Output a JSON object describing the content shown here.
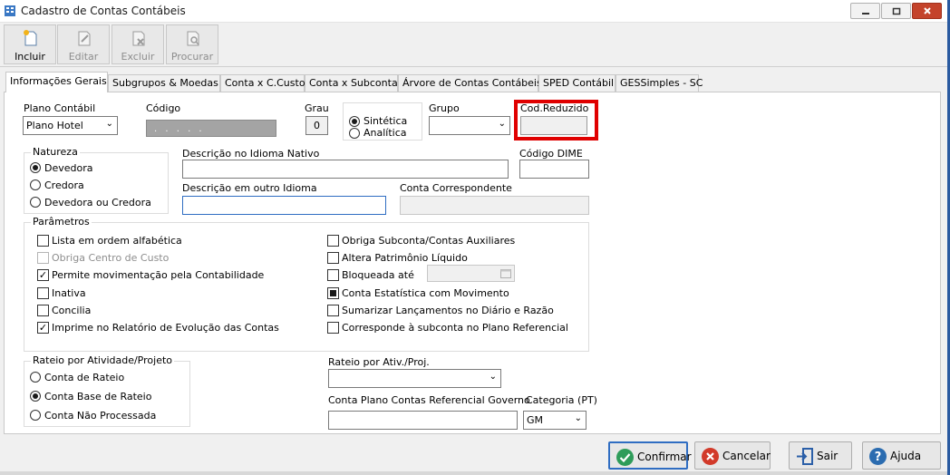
{
  "window": {
    "title": "Cadastro de Contas Contábeis"
  },
  "toolbar": {
    "incluir": "Incluir",
    "editar": "Editar",
    "excluir": "Excluir",
    "procurar": "Procurar"
  },
  "tabs": [
    "Informações Gerais",
    "Subgrupos & Moedas",
    "Conta x C.Custo",
    "Conta x Subconta",
    "Árvore de Contas Contábeis",
    "SPED Contábil",
    "GESSimples - SC"
  ],
  "form": {
    "plano_label": "Plano Contábil",
    "plano_value": "Plano Hotel",
    "codigo_label": "Código",
    "codigo_value": ". . . . .",
    "grau_label": "Grau",
    "grau_value": "0",
    "tipo_sintetica": "Sintética",
    "tipo_analitica": "Analítica",
    "grupo_label": "Grupo",
    "cod_reduzido_label": "Cod.Reduzido",
    "natureza_legend": "Natureza",
    "natureza_options": [
      "Devedora",
      "Credora",
      "Devedora ou Credora"
    ],
    "desc_nativo_label": "Descrição no Idioma Nativo",
    "cod_dime_label": "Código DIME",
    "desc_outro_label": "Descrição em outro Idioma",
    "conta_corresp_label": "Conta Correspondente",
    "parametros_legend": "Parâmetros",
    "params_left": [
      "Lista em ordem alfabética",
      "Obriga Centro de Custo",
      "Permite movimentação pela Contabilidade",
      "Inativa",
      "Concilia",
      "Imprime no Relatório de Evolução das Contas"
    ],
    "params_right": [
      "Obriga Subconta/Contas Auxiliares",
      "Altera Patrimônio Líquido",
      "Bloqueada até",
      "Conta Estatística com Movimento",
      "Sumarizar Lançamentos no Diário e Razão",
      "Corresponde à subconta no Plano Referencial"
    ],
    "rateio_legend": "Rateio por Atividade/Projeto",
    "rateio_options": [
      "Conta de Rateio",
      "Conta Base de Rateio",
      "Conta Não Processada"
    ],
    "rateio_ativ_label": "Rateio por Ativ./Proj.",
    "conta_ref_gov_label": "Conta Plano Contas Referencial Governo",
    "categoria_label": "Categoria (PT)",
    "categoria_value": "GM"
  },
  "buttons": {
    "confirmar": "Confirmar",
    "cancelar": "Cancelar",
    "sair": "Sair",
    "ajuda": "Ajuda"
  },
  "colors": {
    "highlight": "#e00000",
    "focus": "#2f6dc2",
    "confirm": "#2e9c5a",
    "cancel": "#d23a2a",
    "help": "#2b6cb0"
  },
  "icons": {
    "window": "ledger-icon",
    "incluir": "new-document-icon",
    "editar": "edit-document-icon",
    "excluir": "delete-document-icon",
    "procurar": "search-document-icon",
    "confirmar": "check-circle-icon",
    "cancelar": "x-circle-icon",
    "sair": "exit-door-icon",
    "ajuda": "question-circle-icon"
  }
}
